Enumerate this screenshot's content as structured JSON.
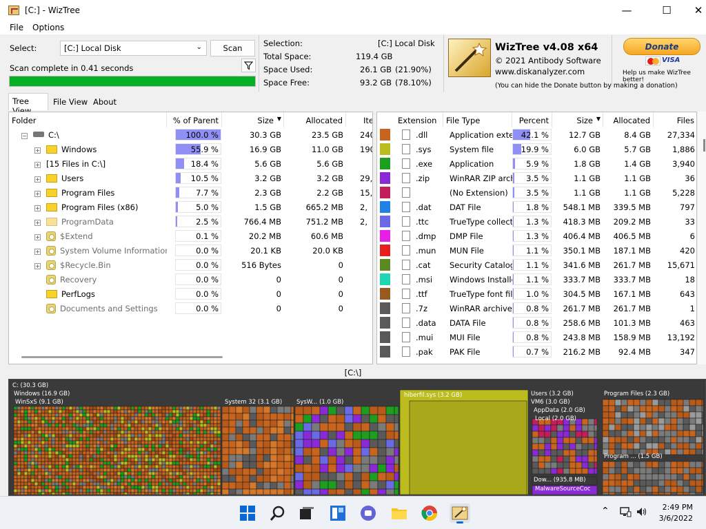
{
  "window": {
    "title": "[C:]  - WizTree"
  },
  "menu": [
    "File",
    "Options"
  ],
  "scan": {
    "select_label": "Select:",
    "drive_value": "[C:] Local Disk",
    "scan_button": "Scan",
    "status": "Scan complete in 0.41 seconds",
    "progress": 1.0
  },
  "selection": {
    "selection_label": "Selection:",
    "selection_value": "[C:]  Local Disk",
    "total_label": "Total Space:",
    "total_value": "119.4 GB",
    "used_label": "Space Used:",
    "used_value": "26.1 GB",
    "used_pct": "(21.90%)",
    "free_label": "Space Free:",
    "free_value": "93.2 GB",
    "free_pct": "(78.10%)"
  },
  "about": {
    "name": "WizTree v4.08 x64",
    "copyright": "© 2021 Antibody Software",
    "site": "www.diskanalyzer.com",
    "donate_note": "(You can hide the Donate button by making a donation)"
  },
  "donate": {
    "button": "Donate",
    "visa": "VISA",
    "caption": "Help us make WizTree better!"
  },
  "tabs": [
    "Tree View",
    "File View",
    "About"
  ],
  "tree": {
    "headers": [
      "Folder",
      "% of Parent",
      "Size",
      "Allocated",
      "Ite"
    ],
    "rows": [
      {
        "name": "C:\\",
        "pct": "100.0 %",
        "frac": 1.0,
        "size": "30.3 GB",
        "alloc": "23.5 GB",
        "items": "240,"
      },
      {
        "name": "Windows",
        "pct": "55.9 %",
        "frac": 0.559,
        "size": "16.9 GB",
        "alloc": "11.0 GB",
        "items": "190,"
      },
      {
        "name": "[15 Files in C:\\]",
        "pct": "18.4 %",
        "frac": 0.184,
        "size": "5.6 GB",
        "alloc": "5.6 GB",
        "items": ""
      },
      {
        "name": "Users",
        "pct": "10.5 %",
        "frac": 0.105,
        "size": "3.2 GB",
        "alloc": "3.2 GB",
        "items": "29,"
      },
      {
        "name": "Program Files",
        "pct": "7.7 %",
        "frac": 0.077,
        "size": "2.3 GB",
        "alloc": "2.2 GB",
        "items": "15,"
      },
      {
        "name": "Program Files (x86)",
        "pct": "5.0 %",
        "frac": 0.05,
        "size": "1.5 GB",
        "alloc": "665.2 MB",
        "items": "2,"
      },
      {
        "name": "ProgramData",
        "pct": "2.5 %",
        "frac": 0.025,
        "size": "766.4 MB",
        "alloc": "751.2 MB",
        "items": "2,"
      },
      {
        "name": "$Extend",
        "pct": "0.1 %",
        "frac": 0.001,
        "size": "20.2 MB",
        "alloc": "60.6 MB",
        "items": ""
      },
      {
        "name": "System Volume Information",
        "pct": "0.0 %",
        "frac": 0,
        "size": "20.1 KB",
        "alloc": "20.0 KB",
        "items": ""
      },
      {
        "name": "$Recycle.Bin",
        "pct": "0.0 %",
        "frac": 0,
        "size": "516 Bytes",
        "alloc": "0",
        "items": ""
      },
      {
        "name": "Recovery",
        "pct": "0.0 %",
        "frac": 0,
        "size": "0",
        "alloc": "0",
        "items": ""
      },
      {
        "name": "PerfLogs",
        "pct": "0.0 %",
        "frac": 0,
        "size": "0",
        "alloc": "0",
        "items": ""
      },
      {
        "name": "Documents and Settings",
        "pct": "0.0 %",
        "frac": 0,
        "size": "0",
        "alloc": "0",
        "items": ""
      }
    ]
  },
  "ext": {
    "headers": [
      "Extension",
      "File Type",
      "Percent",
      "Size",
      "Allocated",
      "Files"
    ],
    "rows": [
      {
        "color": "#c8641e",
        "ext": ".dll",
        "type": "Application exte",
        "pct": "42.1 %",
        "frac": 0.421,
        "size": "12.7 GB",
        "alloc": "8.4 GB",
        "files": "27,334"
      },
      {
        "color": "#bcbc1e",
        "ext": ".sys",
        "type": "System file",
        "pct": "19.9 %",
        "frac": 0.199,
        "size": "6.0 GB",
        "alloc": "5.7 GB",
        "files": "1,886"
      },
      {
        "color": "#1e9e1e",
        "ext": ".exe",
        "type": "Application",
        "pct": "5.9 %",
        "frac": 0.059,
        "size": "1.8 GB",
        "alloc": "1.4 GB",
        "files": "3,940"
      },
      {
        "color": "#8a2ad6",
        "ext": ".zip",
        "type": "WinRAR ZIP arch",
        "pct": "3.5 %",
        "frac": 0.035,
        "size": "1.1 GB",
        "alloc": "1.1 GB",
        "files": "36"
      },
      {
        "color": "#c21e5a",
        "ext": "",
        "type": "(No Extension)",
        "pct": "3.5 %",
        "frac": 0.035,
        "size": "1.1 GB",
        "alloc": "1.1 GB",
        "files": "5,228"
      },
      {
        "color": "#1e82e6",
        "ext": ".dat",
        "type": "DAT File",
        "pct": "1.8 %",
        "frac": 0.018,
        "size": "548.1 MB",
        "alloc": "339.5 MB",
        "files": "797"
      },
      {
        "color": "#6a6ae6",
        "ext": ".ttc",
        "type": "TrueType collecti",
        "pct": "1.3 %",
        "frac": 0.013,
        "size": "418.3 MB",
        "alloc": "209.2 MB",
        "files": "33"
      },
      {
        "color": "#e61ee6",
        "ext": ".dmp",
        "type": "DMP File",
        "pct": "1.3 %",
        "frac": 0.013,
        "size": "406.4 MB",
        "alloc": "406.5 MB",
        "files": "6"
      },
      {
        "color": "#e61e1e",
        "ext": ".mun",
        "type": "MUN File",
        "pct": "1.1 %",
        "frac": 0.011,
        "size": "350.1 MB",
        "alloc": "187.1 MB",
        "files": "420"
      },
      {
        "color": "#5a8a1e",
        "ext": ".cat",
        "type": "Security Catalog",
        "pct": "1.1 %",
        "frac": 0.011,
        "size": "341.6 MB",
        "alloc": "261.7 MB",
        "files": "15,671"
      },
      {
        "color": "#1ed6b2",
        "ext": ".msi",
        "type": "Windows Installe",
        "pct": "1.1 %",
        "frac": 0.011,
        "size": "333.7 MB",
        "alloc": "333.7 MB",
        "files": "18"
      },
      {
        "color": "#9a5a1e",
        "ext": ".ttf",
        "type": "TrueType font fil",
        "pct": "1.0 %",
        "frac": 0.01,
        "size": "304.5 MB",
        "alloc": "167.1 MB",
        "files": "643"
      },
      {
        "color": "#5a5a5a",
        "ext": ".7z",
        "type": "WinRAR archive",
        "pct": "0.8 %",
        "frac": 0.008,
        "size": "261.7 MB",
        "alloc": "261.7 MB",
        "files": "1"
      },
      {
        "color": "#5a5a5a",
        "ext": ".data",
        "type": "DATA File",
        "pct": "0.8 %",
        "frac": 0.008,
        "size": "258.6 MB",
        "alloc": "101.3 MB",
        "files": "463"
      },
      {
        "color": "#5a5a5a",
        "ext": ".mui",
        "type": "MUI File",
        "pct": "0.8 %",
        "frac": 0.008,
        "size": "243.8 MB",
        "alloc": "158.9 MB",
        "files": "13,192"
      },
      {
        "color": "#5a5a5a",
        "ext": ".pak",
        "type": "PAK File",
        "pct": "0.7 %",
        "frac": 0.007,
        "size": "216.2 MB",
        "alloc": "92.4 MB",
        "files": "347"
      }
    ]
  },
  "status_path": "[C:\\]",
  "treemap": {
    "labels": [
      "C: (30.3 GB)",
      "Windows (16.9 GB)",
      "WinSxS (9.1 GB)",
      "System 32 (3.1 GB)",
      "SysW... (1.0 GB)",
      "hiberfil.sys (3.2 GB)",
      "Users (3.2 GB)",
      "VM6 (3.0 GB)",
      "AppData (2.0 GB)",
      "Local (2.0 GB)",
      "Dow... (935.8 MB)",
      "MalwareSourceCoc",
      "Program Files (2.3 GB)",
      "Program ... (1.5 GB)"
    ]
  },
  "taskbar": {
    "time": "2:49 PM",
    "date": "3/6/2022"
  }
}
